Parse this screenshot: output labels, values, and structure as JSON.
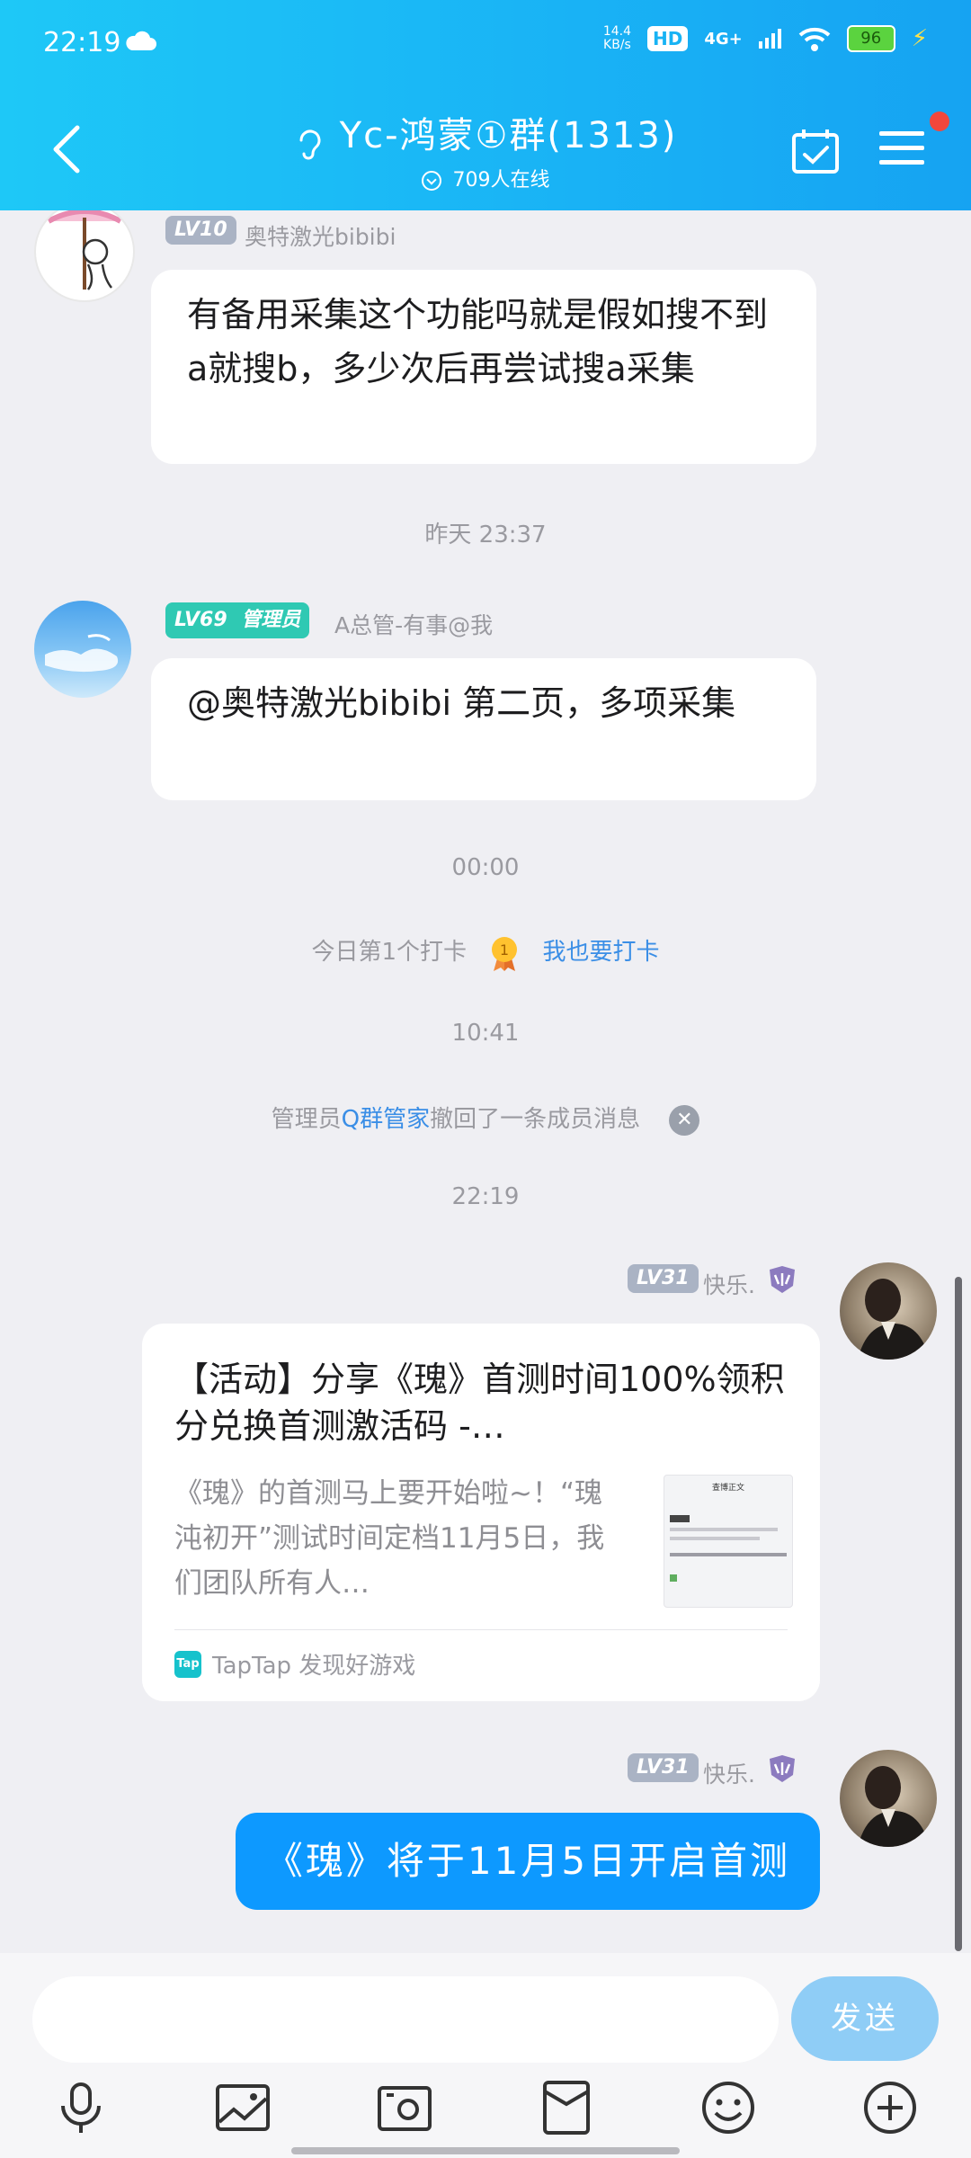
{
  "status_bar": {
    "time": "22:19",
    "net_speed_value": "14.4",
    "net_speed_unit": "KB/s",
    "hd": "HD",
    "signal": "4G+",
    "battery": "96"
  },
  "header": {
    "title": "Yc-鸿蒙①群(1313)",
    "online": "709人在线"
  },
  "messages": {
    "m1": {
      "level": "LV10",
      "nick": "奥特激光bibibi",
      "text": "有备用采集这个功能吗就是假如搜不到a就搜b，多少次后再尝试搜a采集"
    },
    "ts1": "昨天 23:37",
    "m2": {
      "level": "LV69",
      "role": "管理员",
      "nick": "A总管-有事@我",
      "text": "@奥特激光bibibi 第二页，多项采集"
    },
    "ts2": "00:00",
    "checkin": {
      "text": "今日第1个打卡",
      "link": "我也要打卡"
    },
    "ts3": "10:41",
    "recall": {
      "prefix": "管理员",
      "actor": "Q群管家",
      "suffix": "撤回了一条成员消息"
    },
    "ts4": "22:19",
    "m3": {
      "level": "LV31",
      "nick": "快乐.",
      "card_title": "【活动】分享《瑰》首测时间100%领积分兑换首测激活码 -…",
      "card_desc": "《瑰》的首测马上要开始啦~！“瑰沌初开”测试时间定档11月5日，我们团队所有人…",
      "thumb_title": "查博正文",
      "footer_icon": "Tap",
      "footer": "TapTap 发现好游戏"
    },
    "m4": {
      "level": "LV31",
      "nick": "快乐.",
      "text": "《瑰》将于11月5日开启首测"
    }
  },
  "input": {
    "placeholder": "",
    "send": "发送"
  },
  "toolbar": [
    "mic-icon",
    "image-icon",
    "camera-icon",
    "red-packet-icon",
    "emoji-icon",
    "plus-icon"
  ]
}
